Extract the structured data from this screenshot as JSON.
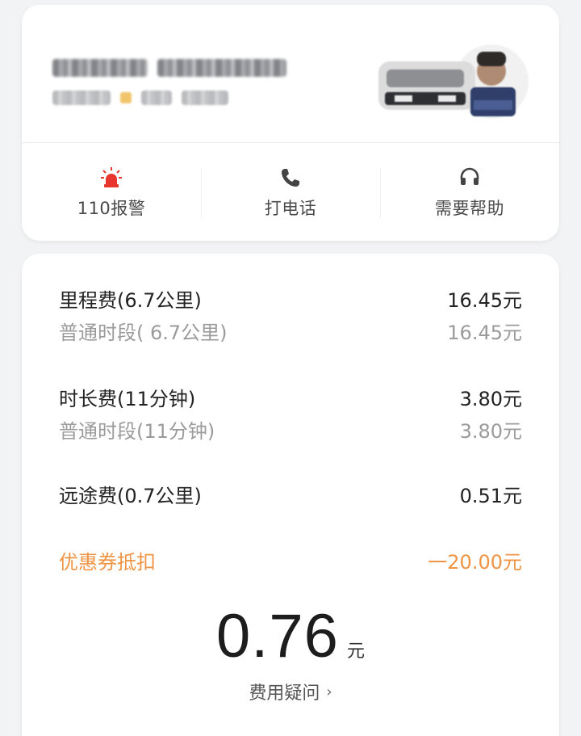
{
  "actions": [
    {
      "label": "110报警",
      "icon": "siren-icon"
    },
    {
      "label": "打电话",
      "icon": "phone-icon"
    },
    {
      "label": "需要帮助",
      "icon": "headset-icon"
    }
  ],
  "fees": {
    "mileage": {
      "label": "里程费(6.7公里)",
      "value": "16.45元",
      "sub_label": "普通时段( 6.7公里)",
      "sub_value": "16.45元"
    },
    "duration": {
      "label": "时长费(11分钟)",
      "value": "3.80元",
      "sub_label": "普通时段(11分钟)",
      "sub_value": "3.80元"
    },
    "long_distance": {
      "label": "远途费(0.7公里)",
      "value": "0.51元"
    },
    "coupon": {
      "label": "优惠券抵扣",
      "value": "一20.00元"
    }
  },
  "total": {
    "amount": "0.76",
    "unit": "元"
  },
  "question": {
    "label": "费用疑问",
    "chevron": "›"
  },
  "colors": {
    "accent_orange": "#ef9444",
    "alarm_red": "#e8352e"
  }
}
